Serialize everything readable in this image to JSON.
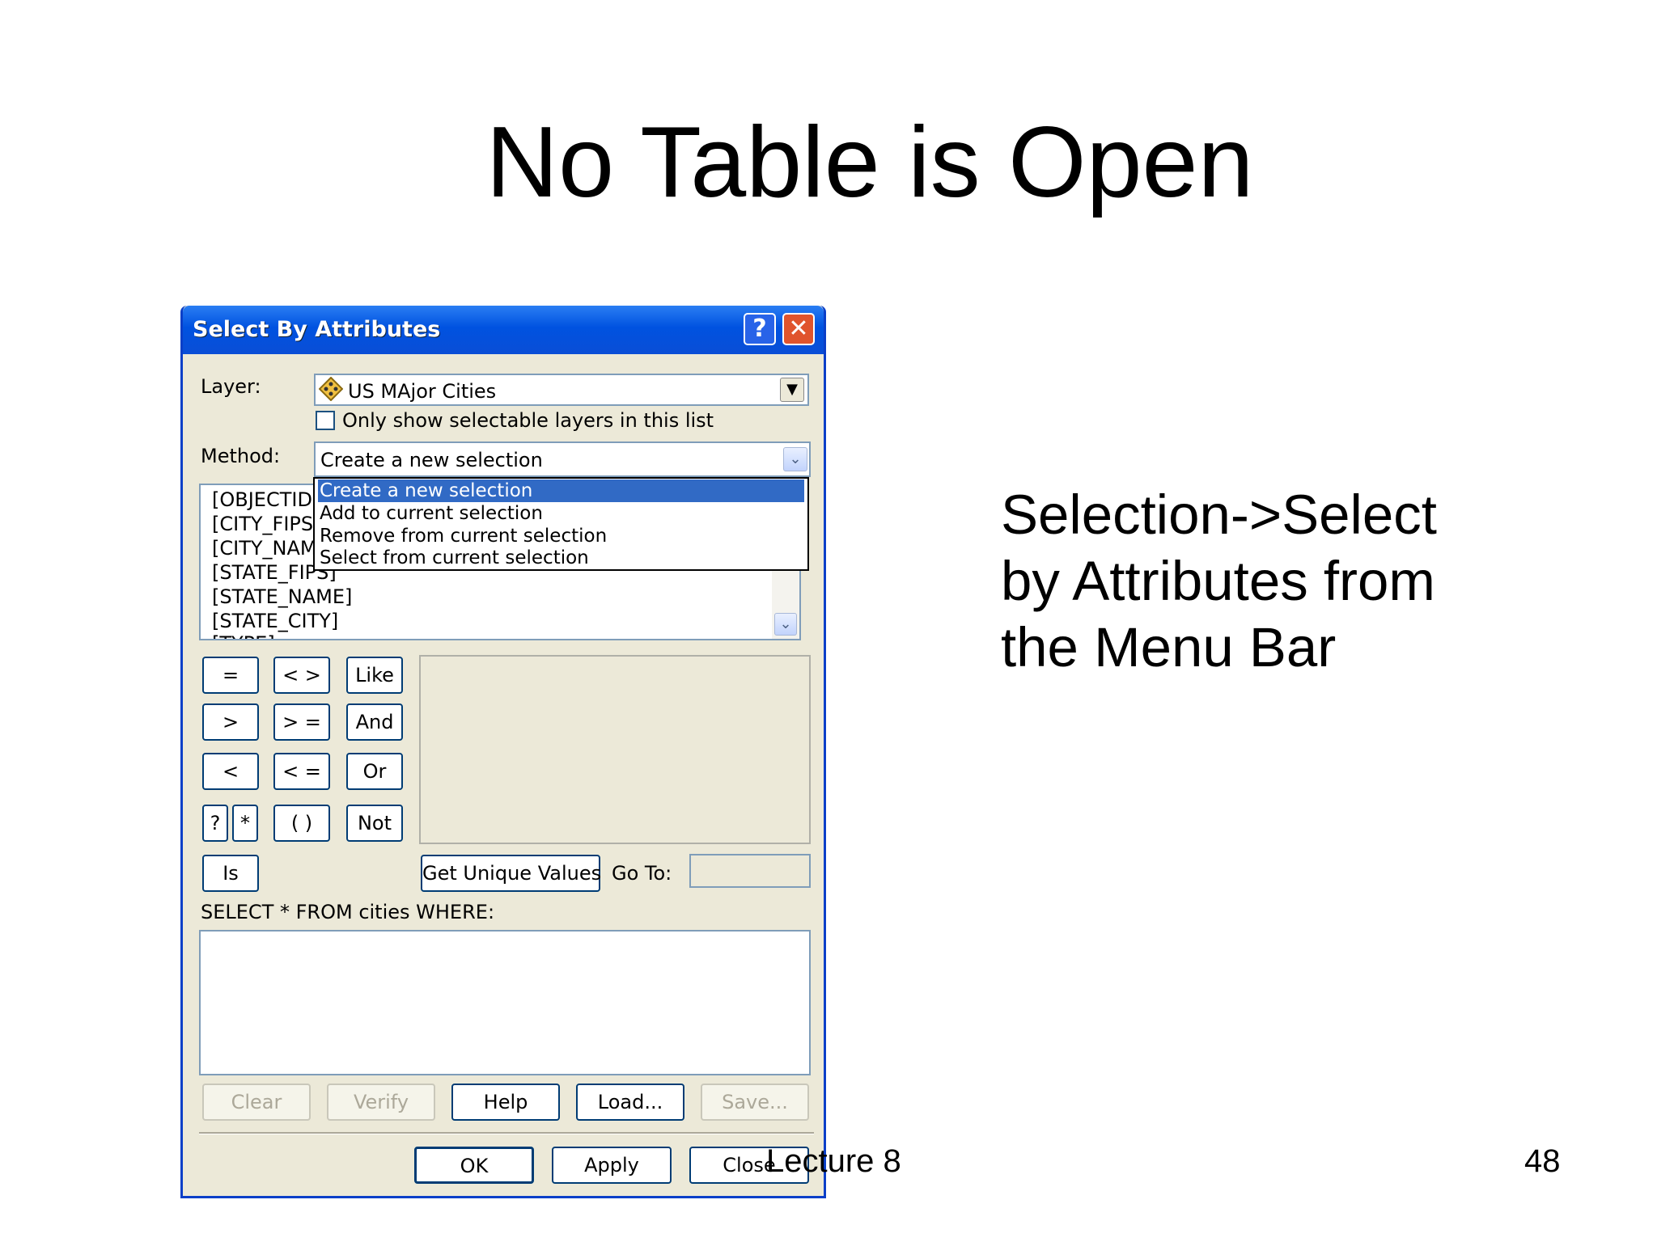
{
  "slide": {
    "title": "No Table is Open",
    "side_text": "Selection->Select by Attributes from the Menu Bar",
    "footer_center": "Lecture 8",
    "page_number": "48"
  },
  "dialog": {
    "title": "Select By Attributes",
    "help_symbol": "?",
    "close_symbol": "✕",
    "layer_label": "Layer:",
    "layer_value": "US MAjor Cities",
    "only_selectable_label": "Only show selectable layers in this list",
    "only_selectable_checked": false,
    "method_label": "Method:",
    "method_value": "Create a new selection",
    "method_options": [
      "Create a new selection",
      "Add to current selection",
      "Remove from current selection",
      "Select from current selection"
    ],
    "fields": [
      "[OBJECTID]",
      "[CITY_FIPS]",
      "[CITY_NAM",
      "[STATE_FIPS]",
      "[STATE_NAME]",
      "[STATE_CITY]",
      "[TYPE]"
    ],
    "operators": {
      "eq": "=",
      "ne": "< >",
      "like": "Like",
      "gt": ">",
      "ge": "> =",
      "and": "And",
      "lt": "<",
      "le": "< =",
      "or": "Or",
      "q": "?",
      "star": "*",
      "paren": "( )",
      "not": "Not",
      "is": "Is"
    },
    "get_unique_values": "Get Unique Values",
    "goto_label": "Go To:",
    "goto_value": "",
    "query_prefix": "SELECT * FROM cities WHERE:",
    "query_text": "",
    "buttons": {
      "clear": "Clear",
      "verify": "Verify",
      "help": "Help",
      "load": "Load...",
      "save": "Save...",
      "ok": "OK",
      "apply": "Apply",
      "close": "Close"
    }
  },
  "colors": {
    "titlebar": "#0a4ed6",
    "dialog_bg": "#ece9d8",
    "highlight": "#316ac5"
  }
}
